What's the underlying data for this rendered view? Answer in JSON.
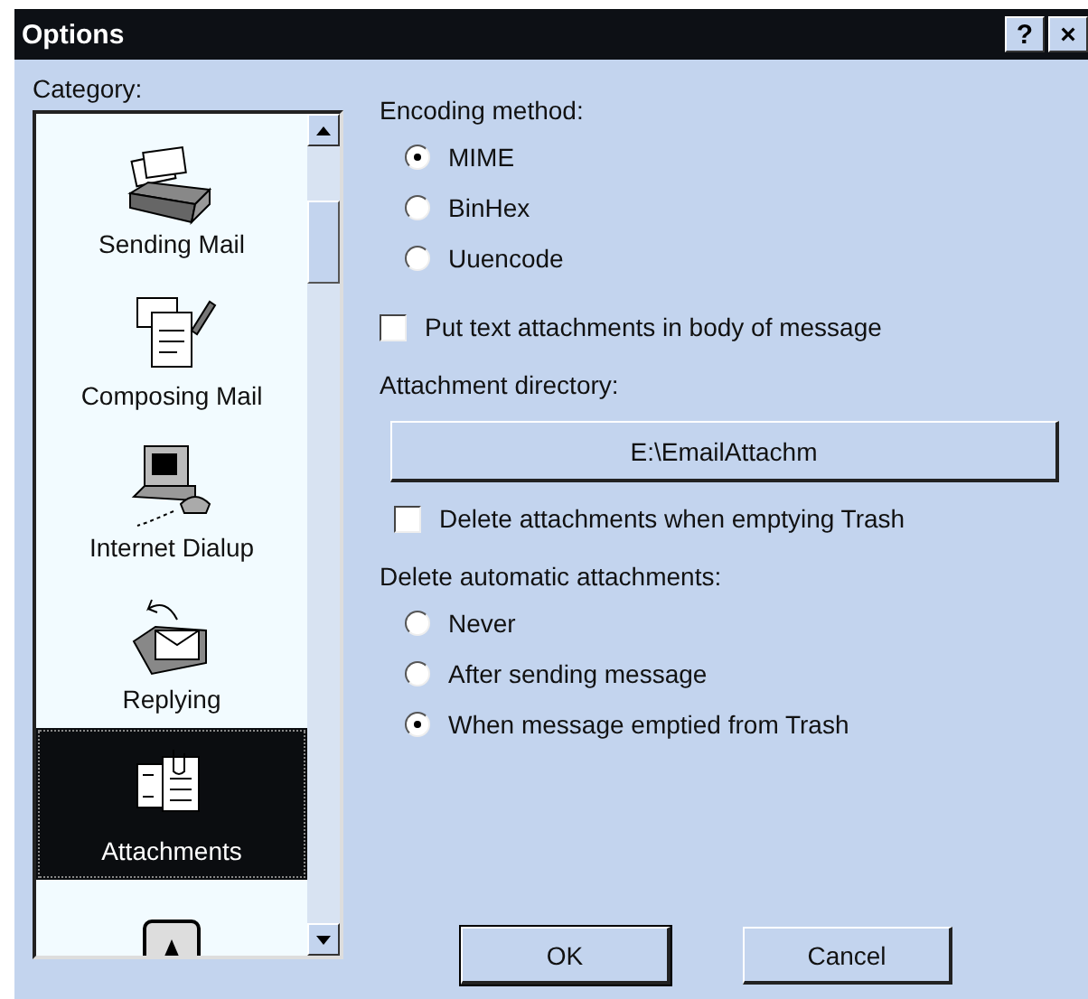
{
  "window": {
    "title": "Options",
    "buttons": [
      "?",
      "×"
    ]
  },
  "category": {
    "label": "Category:",
    "items": [
      {
        "label": "Sending Mail",
        "selected": false
      },
      {
        "label": "Composing Mail",
        "selected": false
      },
      {
        "label": "Internet Dialup",
        "selected": false
      },
      {
        "label": "Replying",
        "selected": false
      },
      {
        "label": "Attachments",
        "selected": true
      },
      {
        "selected": false
      }
    ]
  },
  "encoding": {
    "label": "Encoding method:",
    "options": [
      {
        "label": "MIME",
        "selected": true
      },
      {
        "label": "BinHex",
        "selected": false
      },
      {
        "label": "Uuencode",
        "selected": false
      }
    ]
  },
  "body_checkbox": {
    "label": "Put text attachments in body of message",
    "checked": false
  },
  "directory": {
    "label": "Attachment directory:",
    "value": "E:\\EmailAttachm"
  },
  "trash_checkbox": {
    "label": "Delete attachments when emptying Trash",
    "checked": false
  },
  "auto_delete": {
    "label": "Delete automatic attachments:",
    "options": [
      {
        "label": "Never",
        "selected": false
      },
      {
        "label": "After sending message",
        "selected": false
      },
      {
        "label": "When message emptied from Trash",
        "selected": true
      }
    ]
  },
  "buttons": [
    "OK",
    "Cancel"
  ]
}
